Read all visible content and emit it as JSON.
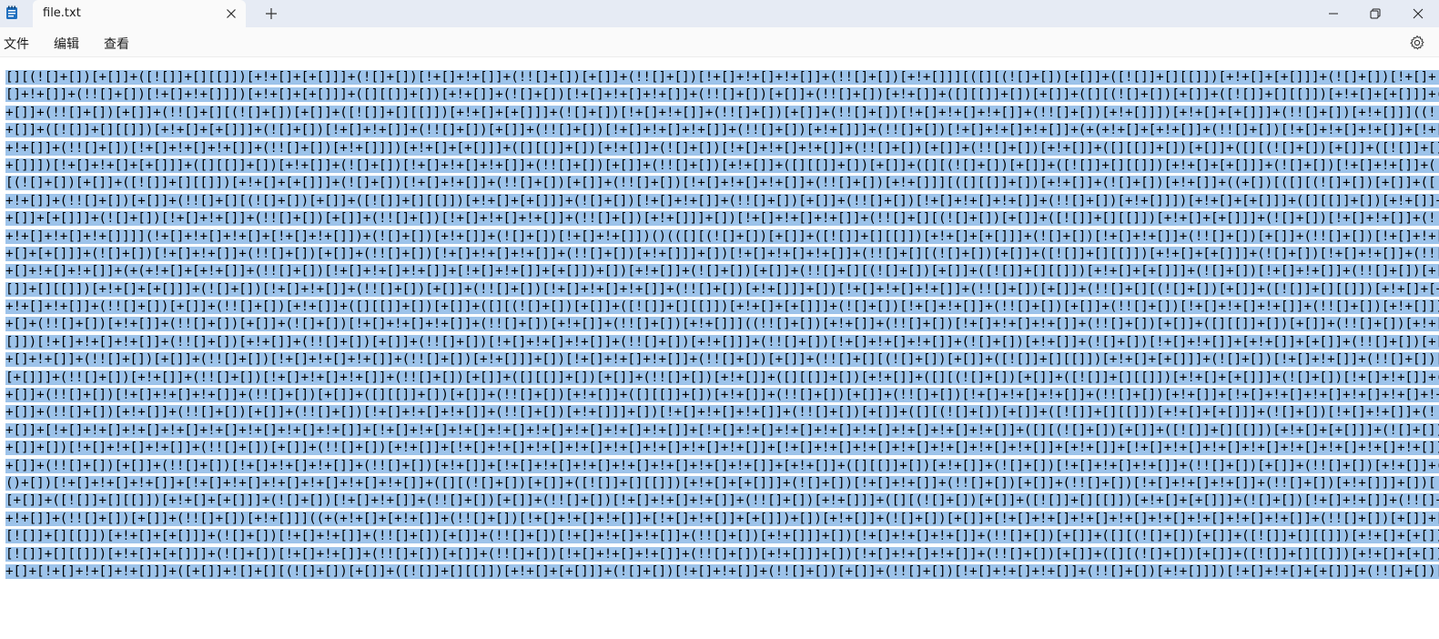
{
  "window": {
    "tab_title": "file.txt"
  },
  "menu": {
    "file": "文件",
    "edit": "编辑",
    "view": "查看"
  },
  "icons": {
    "app": "notepad-icon",
    "tab_close": "close-icon",
    "new_tab": "plus-icon",
    "minimize": "minimize-icon",
    "maximize": "restore-icon",
    "close": "close-icon",
    "settings": "gear-icon"
  },
  "colors": {
    "selection": "#9dc3ea",
    "titlebar": "#e6ebf4"
  },
  "editor": {
    "lines": [
      "[][(![]+[])[+[]]+([![]]+[][[]])[+!+[]+[+[]]]+(![]+[])[!+[]+!+[]]+(!![]+[])[+[]]+(!![]+[])[!+[]+!+[]+!+[]]+(!![]+[])[+!+[]]][([][(![]+[])[+[]]+([![]]+[][[]])[+!+[]+[+[]]]+(![]+[])[!+[]+!+[]]+(!![]+[])[+[]]+(!![]+[])[!+[]+!+[]+!+[]]+(!![]+[])[+!+[]]]+[])[!+[]+!+[]+!+[]]+(!![]+[][(![]+[])[+[]]+([![]]+[][[]])[+!+[]+[+[]]]+(![]+[])[!+[]+!+[]]+(!",
      "[]+!+[]]+(!![]+[])[!+[]+!+[]]])[+!+[]+[+[]]]+([][[]]+[])[+!+[]]+(![]+[])[!+[]+!+[]+!+[]]+(!![]+[])[+[]]+(!![]+[])[+!+[]]+([][[]]+[])[+[]]+([][(![]+[])[+[]]+([![]]+[][[]])[+!+[]+[+[]]]+(![]+[])[!+[]+!+[]]+(!![]+[])[+[]]+(!![]+[])[!+[]+!+[]+!+[]]+(!![]+[])[+!+[]]]+[])[!+[]+!+[]+!",
      "+[]]+(!![]+[])[+[]]+(!![]+[][(![]+[])[+[]]+([![]]+[][[]])[+!+[]+[+[]]]+(![]+[])[!+[]+!+[]]+(!![]+[])[+[]]+(!![]+[])[!+[]+!+[]+!+[]]+(!![]+[])[+!+[]]])[+!+[]+[+[]]]+(!![]+[])[+!+[]]]((!![]+[])[+!+[]]+(!![]+[])[!+[]+!+[]+!+[]]+(!![]+[])[+[]]+([][[]]+[])[+[]]+(!![]+[])[+!+[]]+([][[]]+[])[+!",
      "+[]]+([![]]+[][[]])[+!+[]+[+[]]]+(![]+[])[!+[]+!+[]]+(!![]+[])[+[]]+(!![]+[])[!+[]+!+[]+!+[]]+(!![]+[])[+!+[]]]+(!![]+[])[!+[]+!+[]+!+[]]+(+(+!+[]+[+!+[]]+(!![]+[])[!+[]+!+[]+!+[]]+[!+[]+!+[]]+[+[]])+[])[+!+[]]+(![]+[])[+[]]+(!![]+[][(![]+[])[+[]]+([![]]+[][[]])[+!+[]+[+[]]]+(![]+[])[!",
      "+!+[]]+(!![]+[])[!+[]+!+[]+!+[]]+(!![]+[])[+!+[]]])[+!+[]+[+[]]]+([][[]]+[])[+!+[]]+(![]+[])[!+[]+!+[]+!+[]]+(!![]+[])[+[]]+(!![]+[])[+!+[]]+([][[]]+[])[+[]]+([][(![]+[])[+[]]+([![]]+[][[]])[+!+[]+[+[]]]+(![]+[])[!+[]+!+[]]+(!![]+[])[+[]]+(!![]+[])[!+[]+!+[]+!+[]]+(!![]+[])[+!",
      "+[]]])[!+[]+!+[]+[+[]]]+([][[]]+[])[+!+[]]+(![]+[])[!+[]+!+[]+!+[]]+(!![]+[])[+[]]+(!![]+[])[+!+[]]+([][[]]+[])[+[]]+([][(![]+[])[+[]]+([![]]+[][[]])[+!+[]+[+[]]]+(![]+[])[!+[]+!+[]]+(!![]+[])[+[]]+(!![]+[])[!+[]+!+[]+!+[]]+(!![]+[])[+!+[]]]+[])[!+[]+!+[]+!+[]]+(!![]+[])[+[]]+(!![]",
      "[(![]+[])[+[]]+([![]]+[][[]])[+!+[]+[+[]]]+(![]+[])[!+[]+!+[]]+(!![]+[])[+[]]+(!![]+[])[!+[]+!+[]+!+[]]+(!![]+[])[+!+[]]][([][[]]+[])[+!+[]]+(![]+[])[+!+[]]+((+[])[([][(![]+[])[+[]]+([![]]+[][[]])[+!+[]+[+[]]]+(![]+[])[!+[]+!+[]]+(!![]+[])[+[]]+(!![]+[])[!+[]+!+[]+!+[]]+(!![]+[])[",
      "+!+[]]+(!![]+[])[+[]]+(!![]+[][(![]+[])[+[]]+([![]]+[][[]])[+!+[]+[+[]]]+(![]+[])[!+[]+!+[]]+(!![]+[])[+[]]+(!![]+[])[!+[]+!+[]+!+[]]+(!![]+[])[+!+[]]])[+!+[]+[+[]]]+([][[]]+[])[+!+[]]+(![]+[])[!+[]+!+[]+!+[]]+(!![]+[])[+[]]+(!![]+[])[+!+[]]+([][[]]+[])[+[]]+([][(![]+[])[+[]]+([![]]+[][[]])[+!+[]+[",
      "+[]]+[+[]]]+(![]+[])[!+[]+!+[]]+(!![]+[])[+[]]+(!![]+[])[!+[]+!+[]+!+[]]+(!![]+[])[+!+[]]]+[])[!+[]+!+[]+!+[]]+(!![]+[][(![]+[])[+[]]+([![]]+[][[]])[+!+[]+[+[]]]+(![]+[])[!+[]+!+[]]+(!![]+[])[+[]]+(!![]+[])[!+[]+!+[]+!+[]]+(!![]+[])[+!+[]]])[+!+[]+[+[]]]+(!![]+[])[+!+[]]]+[])[+!+[]+[",
      "+!+[]+!+[]+!+[]]]](!+[]+!+[]+!+[]+[!+[]+!+[]])+(![]+[])[+!+[]]+(![]+[])[!+[]+!+[]])()(([][(![]+[])[+[]]+([![]]+[][[]])[+!+[]+[+[]]]+(![]+[])[!+[]+!+[]]+(!![]+[])[+[]]+(!![]+[])[!+[]+!+[]+!+[]]+(!![]+[])[+!+[]]][([][(![]+[])[+[]]+([![]]+[][[]])[+!+[]+[+[]]]+(![]+[])[!+[]+!+[]]+(!",
      "+[]+[+[]]]+(![]+[])[!+[]+!+[]]+(!![]+[])[+[]]+(!![]+[])[!+[]+!+[]+!+[]]+(!![]+[])[+!+[]]]+[])[!+[]+!+[]+!+[]]+(!![]+[][(![]+[])[+[]]+([![]]+[][[]])[+!+[]+[+[]]]+(![]+[])[!+[]+!+[]]+(!![]+[])[+[]]+(!![]+[])[!+[]+!+[]+!+[]]+(!![]+[])[+!+[]]])[+!+[]+[+[]]]+([][[]]+[])[+!+[]]+(!![]",
      "+[]+!+[]+!+[]]+(+(+!+[]+[+!+[]]+(!![]+[])[!+[]+!+[]+!+[]]+[!+[]+!+[]]+[+[]])+[])[+!+[]]+(![]+[])[+[]]+(!![]+[][(![]+[])[+[]]+([![]]+[][[]])[+!+[]+[+[]]]+(![]+[])[!+[]+!+[]]+(!![]+[])[+[]]+(!![]+[])[!+[]+!+[]+!+[]]+(!![]+[])[+!+[]]])[+!+[]+[+[]]]+(!+[]+[][(![]+[])[+[]]+([![]",
      "[]]+[][[]])[+!+[]+[+[]]]+(![]+[])[!+[]+!+[]]+(!![]+[])[+[]]+(!![]+[])[!+[]+!+[]+!+[]]+(!![]+[])[+!+[]]]+[])[!+[]+!+[]+!+[]]+(!![]+[])[+[]]+(!![]+[][(![]+[])[+[]]+([![]]+[][[]])[+!+[]+[+[]]]+(![]+[])[!+[]+!+[]]+(!![]+[])[+[]]+(!![]+[])[!+[]+!+[]+!+[]]+(!![]+[])[+!+[]]])[+!+[]+",
      "+!+[]+!+[]]+(!![]+[])[+[]]+(!![]+[])[+!+[]]+([][[]]+[])[+[]]+([][(![]+[])[+[]]+([![]]+[][[]])[+!+[]+[+[]]]+(![]+[])[!+[]+!+[]]+(!![]+[])[+[]]+(!![]+[])[!+[]+!+[]+!+[]]+(!![]+[])[+!+[]]]+[])[!+[]+!+[]+!+[]]+(!![]+[])[+[]]+(!![]+[][(![]+[])[+[]]+([![]]+[][[]])[+!+[]+[+[]]]+(!",
      "+[]+(!![]+[])[+!+[]]+(!![]+[])[+[]]+(![]+[])[!+[]+!+[]+!+[]]+(!![]+[])[+!+[]]+(!![]+[])[+!+[]]]((!![]+[])[+!+[]]+(!![]+[])[!+[]+!+[]+!+[]]+(!![]+[])[+[]]+([][[]]+[])[+[]]+(!![]+[])[+!+[]]+([][[]]+[])[+!+[]]+(+[![]]+[][(![]+[])[+[]]+([![]]+[][[]])[+!+[]+[+[]]]+(![]+[])[!+[]+!+[]]+(!![]",
      "[]])[!+[]+!+[]+!+[]]+(!![]+[])[+!+[]]+(!![]+[])[+[]]+(!![]+[])[!+[]+!+[]+!+[]]+(!![]+[])[+!+[]]]+(!![]+[])[!+[]+!+[]+!+[]]+(![]+[])[+!+[]]+(![]+[])[!+[]+!+[]]+[+!+[]]+[+[]]+(!![]+[])[+[]]+(!![]+[])[!+[]+!+[]+!+[]]+(!![]+[])[+!+[]]+[][(![]+[])[+[]]+([![]]+[][[]])[+!+[]+[+[]]]+(!",
      "+[]+!+[]]+(!![]+[])[+[]]+(!![]+[])[!+[]+!+[]+!+[]]+(!![]+[])[+!+[]]]+[])[!+[]+!+[]+!+[]]+(!![]+[])[+[]]+(!![]+[][(![]+[])[+[]]+([![]]+[][[]])[+!+[]+[+[]]]+(![]+[])[!+[]+!+[]]+(!![]+[])[+[]]+(!![]+[])[!+[]+!+[]+!+[]]+(!![]+[])[+!+[]]])[+!+[]+[+[]]]+(!![]+[])[+!+[]]]+[])[+!+[]+",
      "[+[]]]+(!![]+[])[+!+[]]+(!![]+[])[!+[]+!+[]+!+[]]+(!![]+[])[+[]]+([][[]]+[])[+[]]+(!![]+[])[+!+[]]+([][[]]+[])[+!+[]]+([][(![]+[])[+[]]+([![]]+[][[]])[+!+[]+[+[]]]+(![]+[])[!+[]+!+[]]+(!![]+[])[+[]]+(!![]+[])[!+[]+!+[]+!+[]]+(!![]+[])[+!+[]]]+[])[!+[]+!+[]+!+[]]+(!![]+[])[+[]]",
      "+[]]+(!![]+[])[!+[]+!+[]+!+[]]+(!![]+[])[+[]]+([][[]]+[])[+[]]+(!![]+[])[+!+[]]+([][[]]+[])[+!+[]]+(!![]+[])[+[]]+(!![]+[])[!+[]+!+[]+!+[]]+(!![]+[])[+!+[]]+[!+[]+!+[]+!+[]+!+[]+!+[]+!+[]]+[!+[]+!+[]+!+[]+!+[]+!+[]+!+[]+!+[]]+([][(![]+[])[+[]]+([![]]+[][[]])[+!+[]+[+[]]]+(!",
      "+[]]+(!![]+[])[+!+[]]+(!![]+[])[+[]]+(!![]+[])[!+[]+!+[]+!+[]]+(!![]+[])[+!+[]]]+[])[!+[]+!+[]+!+[]]+(!![]+[])[+[]]+([][(![]+[])[+[]]+([![]]+[][[]])[+!+[]+[+[]]]+(![]+[])[!+[]+!+[]]+(!![]+[])[+[]]+(!![]+[])[!+[]+!+[]+!+[]]+(!![]+[])[+!+[]]]+[])[!+[]+!+[]+!+[]]+(!![]+[])[+!",
      "+[]]+[!+[]+!+[]+!+[]+!+[]+!+[]+!+[]+!+[]+!+[]]+[!+[]+!+[]+!+[]+!+[]+!+[]+!+[]+!+[]+!+[]]+[!+[]+!+[]+!+[]+!+[]+!+[]+!+[]+!+[]+!+[]]+([][(![]+[])[+[]]+([![]]+[][[]])[+!+[]+[+[]]]+(![]+[])[!+[]+!+[]]+(!![]+[])[+[]]+(!![]+[])[!+[]+!+[]+!+[]]+(!![]+[])[+!",
      "+[]]+[])[!+[]+!+[]+!+[]]+(!![]+[])[+[]]+(!![]+[])[+!+[]]+[!+[]+!+[]+!+[]+!+[]+!+[]+!+[]+!+[]+!+[]]+[!+[]+!+[]+!+[]+!+[]+!+[]+!+[]+!+[]]+[+!+[]]+[!+[]+!+[]+!+[]+!+[]+!+[]+!+[]+!+[]+!+[]]+(!![]+[])[+[]]+[!+[]+!+[]+!+[]+!+[]+!+[]]+[!+[]+!+[]+!+[]+!",
      "+[]]+(!![]+[])[+[]]+(!![]+[])[!+[]+!+[]+!+[]]+(!![]+[])[+!+[]]+[!+[]+!+[]+!+[]+!+[]+!+[]+!+[]+!+[]]+[+!+[]]+([][[]]+[])[+!+[]]+(![]+[])[!+[]+!+[]+!+[]]+(!![]+[])[+[]]+(!![]+[])[+!+[]]+([![]]+[][[]])[+!+[]+[+[]]]+(!![]+[])[!+[]+!+[]+!+[]]+(!![]+[])[+[]]+[!+[]+!+[]+!+[]]",
      "()+[])[!+[]+!+[]+!+[]]+[!+[]+!+[]+!+[]+!+[]+!+[]+!+[]]+([][(![]+[])[+[]]+([![]]+[][[]])[+!+[]+[+[]]]+(![]+[])[!+[]+!+[]]+(!![]+[])[+[]]+(!![]+[])[!+[]+!+[]+!+[]]+(!![]+[])[+!+[]]]+[])[!+[]+!+[]+!+[]]+(!![]+[])[+[]]+(!![]+[])[+!+[]]+(([![]]+[][[]])[+!+[]+[+[]]]+(!![]+[])",
      "[+[]]+([![]]+[][[]])[+!+[]+[+[]]]+(![]+[])[!+[]+!+[]]+(!![]+[])[+[]]+(!![]+[])[!+[]+!+[]+!+[]]+(!![]+[])[+!+[]]]+([][(![]+[])[+[]]+([![]]+[][[]])[+!+[]+[+[]]]+(![]+[])[!+[]+!+[]]+(!![]+[])[+[]]+(!![]+[])[!+[]+!+[]+!+[]]+(!![]+[])[+!+[]]]+[])[!+[]+!+[]+!+[]]+(!![]+[])[+[]]+(!",
      "+!+[]]+(!![]+[])[+[]]+(!![]+[])[+!+[]]]((+(+!+[]+[+!+[]]+(!![]+[])[!+[]+!+[]+!+[]]+[!+[]+!+[]]+[+[]])+[])[+!+[]]+(![]+[])[+[]]+[!+[]+!+[]+!+[]+!+[]+!+[]+!+[]+!+[]+!+[]]+(!![]+[])[+[]]+[!+[]+!+[]+!+[]+!+[]+!+[]]+[!+[]+!+[]+!+[]]+[+!+[]]+(!![]+[])[+[]]+(!![]+[])[+!",
      "[![]]+[][[]])[+!+[]+[+[]]]+(![]+[])[!+[]+!+[]]+(!![]+[])[+[]]+(!![]+[])[!+[]+!+[]+!+[]]+(!![]+[])[+!+[]]]+[])[!+[]+!+[]+!+[]]+(!![]+[])[+[]]+([][(![]+[])[+[]]+([![]]+[][[]])[+!+[]+[+[]]]+(![]+[])[!+[]+!+[]]+(!![]+[])[+[]]+(!![]+[])[!+[]+!+[]+!+[]]+(!![]+[])[+!+[]]]+[])[",
      "[![]]+[][[]])[+!+[]+[+[]]]+(![]+[])[!+[]+!+[]]+(!![]+[])[+[]]+(!![]+[])[!+[]+!+[]+!+[]]+(!![]+[])[+!+[]]]+[])[!+[]+!+[]+!+[]]+(!![]+[])[+[]]+([][(![]+[])[+[]]+([![]]+[][[]])[+!+[]+[+[]]]+(![]+[])[!+[]+!+[]]+(!![]+[])[+[]]+(!![]+[])[!+[]+!+[]+!+[]]+(!![]+[])[+!+[]]]+[])[+!",
      "+[]+[!+[]+!+[]+!+[]]]+([+[]]+![]+[][(![]+[])[+[]]+([![]]+[][[]])[+!+[]+[+[]]]+(![]+[])[!+[]+!+[]]+(!![]+[])[+[]]+(!![]+[])[!+[]+!+[]+!+[]]+(!![]+[])[+!+[]]])[!+[]+!+[]+[+[]]]+(!![]+[])[+[]]+(!![]+[])[+!+[]]+[!+[]+!+[]+!+[]+!+[]]+[+[]])"
    ]
  }
}
